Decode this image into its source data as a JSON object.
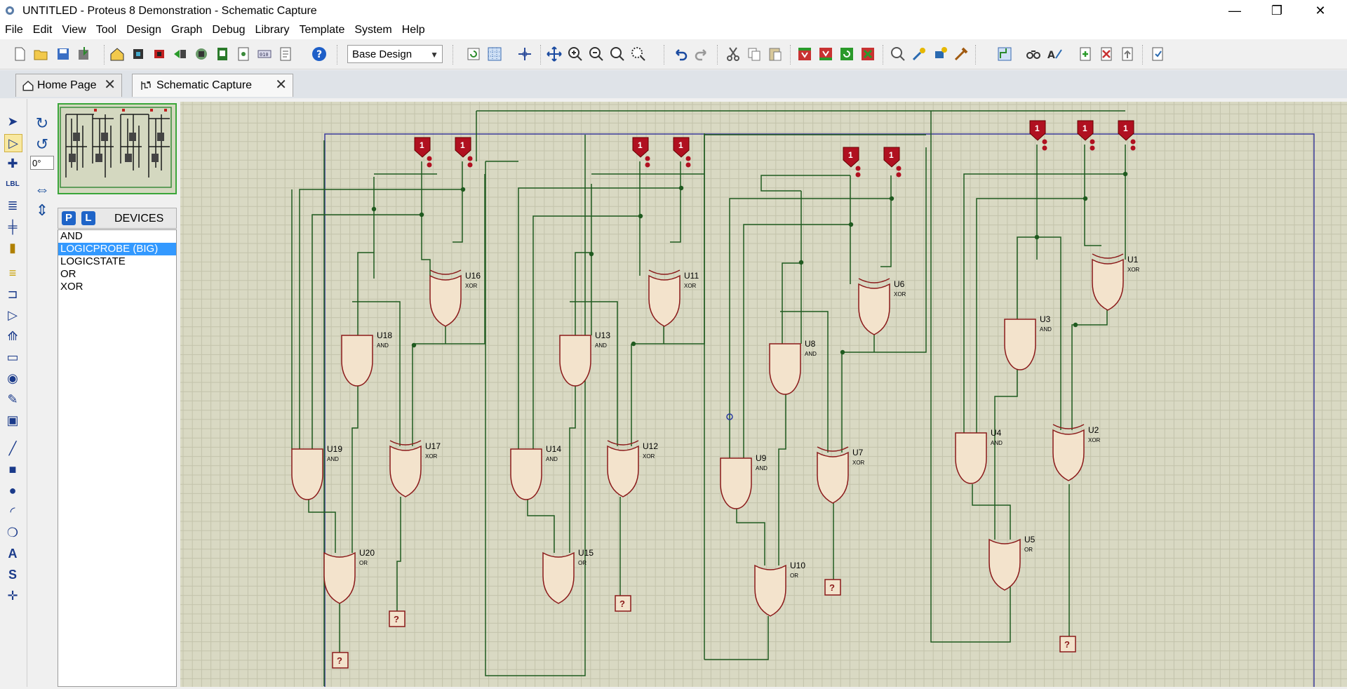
{
  "window": {
    "title": "UNTITLED - Proteus 8 Demonstration - Schematic Capture",
    "minimize": "—",
    "maximize": "❐",
    "close": "✕"
  },
  "menu": [
    "File",
    "Edit",
    "View",
    "Tool",
    "Design",
    "Graph",
    "Debug",
    "Library",
    "Template",
    "System",
    "Help"
  ],
  "toolbar": {
    "design_select": "Base Design"
  },
  "tabs": [
    {
      "label": "Home Page",
      "close": "✕"
    },
    {
      "label": "Schematic Capture",
      "close": "✕"
    }
  ],
  "rotation": {
    "angle": "0°"
  },
  "devices": {
    "p_label": "P",
    "l_label": "L",
    "header": "DEVICES",
    "items": [
      "AND",
      "LOGICPROBE (BIG)",
      "LOGICSTATE",
      "OR",
      "XOR"
    ],
    "selected": "LOGICPROBE (BIG)"
  },
  "schematic": {
    "gates": [
      {
        "ref": "U16",
        "type": "XOR"
      },
      {
        "ref": "U18",
        "type": "AND"
      },
      {
        "ref": "U19",
        "type": "AND"
      },
      {
        "ref": "U17",
        "type": "XOR"
      },
      {
        "ref": "U20",
        "type": "OR"
      },
      {
        "ref": "U11",
        "type": "XOR"
      },
      {
        "ref": "U13",
        "type": "AND"
      },
      {
        "ref": "U14",
        "type": "AND"
      },
      {
        "ref": "U12",
        "type": "XOR"
      },
      {
        "ref": "U15",
        "type": "OR"
      },
      {
        "ref": "U6",
        "type": "XOR"
      },
      {
        "ref": "U8",
        "type": "AND"
      },
      {
        "ref": "U9",
        "type": "AND"
      },
      {
        "ref": "U7",
        "type": "XOR"
      },
      {
        "ref": "U10",
        "type": "OR"
      },
      {
        "ref": "U1",
        "type": "XOR"
      },
      {
        "ref": "U3",
        "type": "AND"
      },
      {
        "ref": "U4",
        "type": "AND"
      },
      {
        "ref": "U2",
        "type": "XOR"
      },
      {
        "ref": "U5",
        "type": "OR"
      }
    ],
    "logicstate_label": "1",
    "probe_label": "?",
    "colors": {
      "grid_bg": "#d9d9c3",
      "grid_line": "#c3c3ab",
      "wire": "#1f5a1f",
      "part": "#8b1a1a",
      "part_fill": "#f3e3cc",
      "sheet_border": "#3a3a9a",
      "logicstate": "#b01020"
    }
  }
}
